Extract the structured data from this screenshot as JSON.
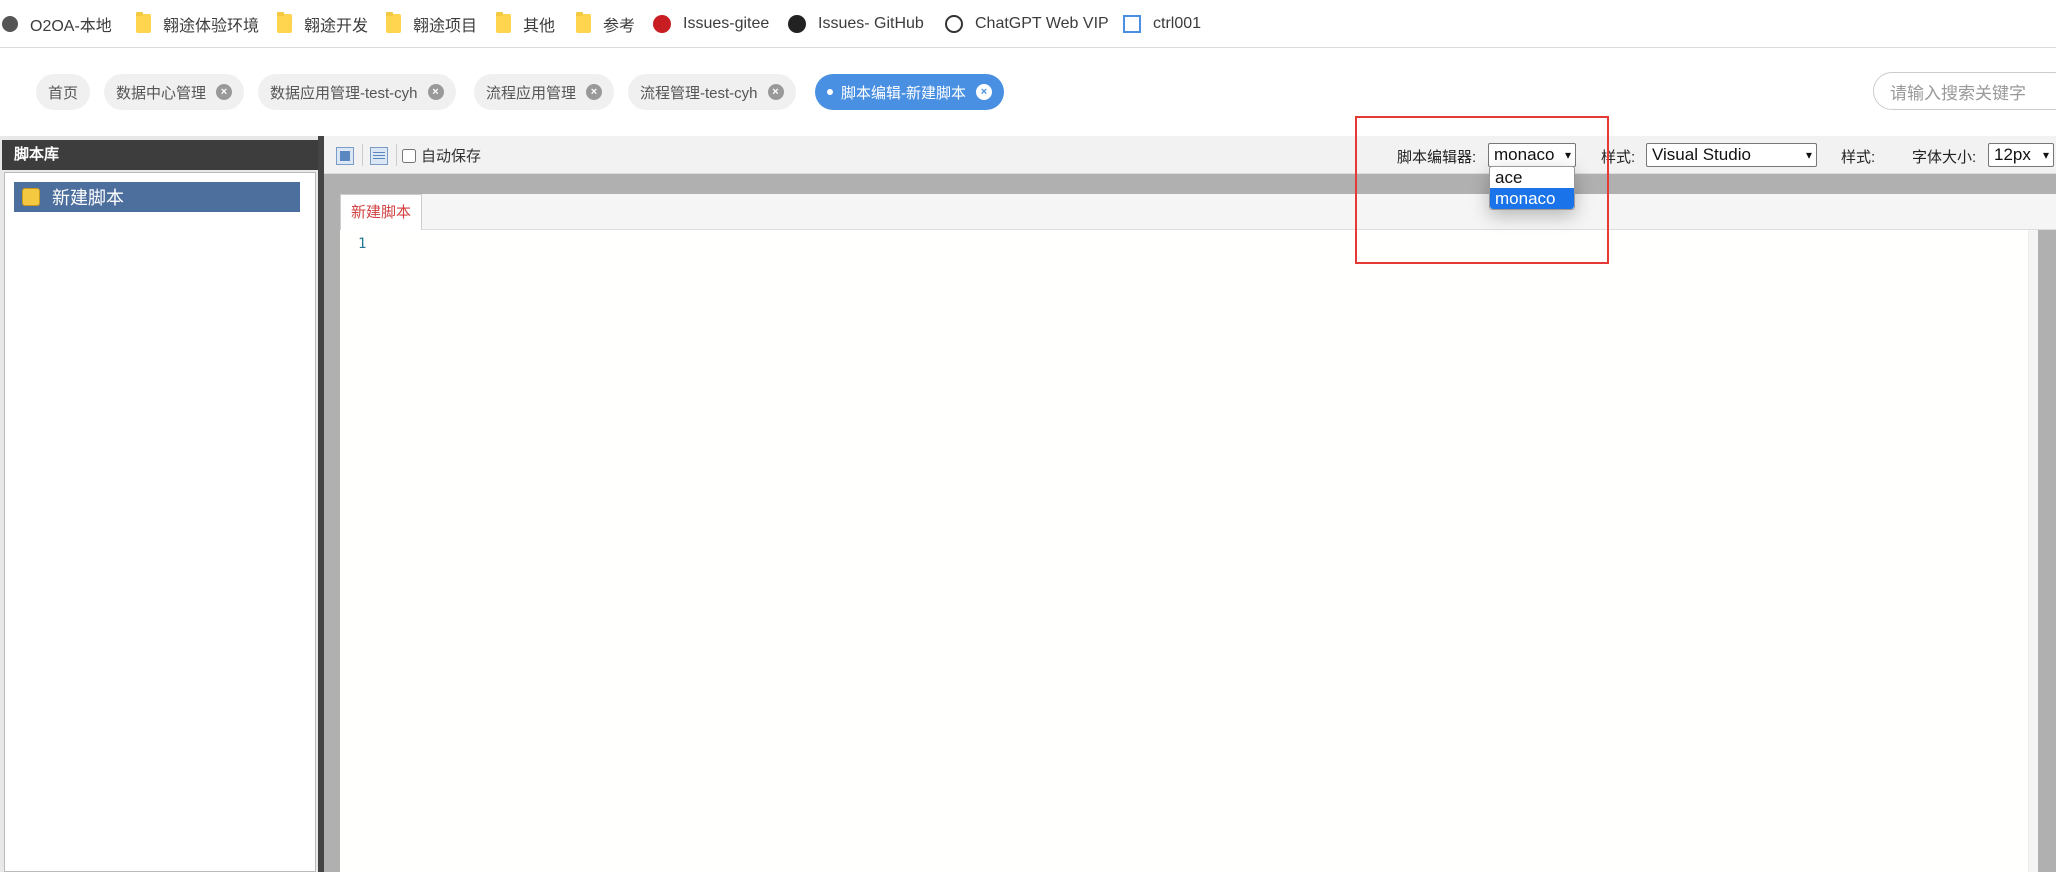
{
  "bookmarks": [
    {
      "label": "O2OA-本地",
      "icon": "globe-icon"
    },
    {
      "label": "翱途体验环境",
      "icon": "folder-icon"
    },
    {
      "label": "翱途开发",
      "icon": "folder-icon"
    },
    {
      "label": "翱途项目",
      "icon": "folder-icon"
    },
    {
      "label": "其他",
      "icon": "folder-icon"
    },
    {
      "label": "参考",
      "icon": "folder-icon"
    },
    {
      "label": "Issues-gitee",
      "icon": "gitee-icon"
    },
    {
      "label": "Issues- GitHub",
      "icon": "github-icon"
    },
    {
      "label": "ChatGPT Web VIP",
      "icon": "openai-icon"
    },
    {
      "label": "ctrl001",
      "icon": "page-icon"
    }
  ],
  "tabs": [
    {
      "label": "首页",
      "closable": false
    },
    {
      "label": "数据中心管理",
      "closable": true
    },
    {
      "label": "数据应用管理-test-cyh",
      "closable": true
    },
    {
      "label": "流程应用管理",
      "closable": true
    },
    {
      "label": "流程管理-test-cyh",
      "closable": true
    },
    {
      "label": "脚本编辑-新建脚本",
      "closable": true,
      "active": true
    }
  ],
  "search": {
    "placeholder": "请输入搜索关键字"
  },
  "left_panel": {
    "title": "脚本库",
    "items": [
      {
        "label": "新建脚本"
      }
    ]
  },
  "toolbar": {
    "autosave_label": "自动保存",
    "editor_label": "脚本编辑器:",
    "editor_value": "monaco",
    "style_label": "样式:",
    "style_value": "Visual Studio",
    "style2_label": "样式:",
    "font_size_label": "字体大小:",
    "font_size_value": "12px"
  },
  "dropdown": {
    "options": [
      "ace",
      "monaco"
    ],
    "selected": "monaco"
  },
  "editor": {
    "tab_label": "新建脚本",
    "line_number": "1"
  },
  "colors": {
    "active_tab": "#4a90e2",
    "highlight_box": "#e53935",
    "tree_selected": "#4d6f9e"
  }
}
